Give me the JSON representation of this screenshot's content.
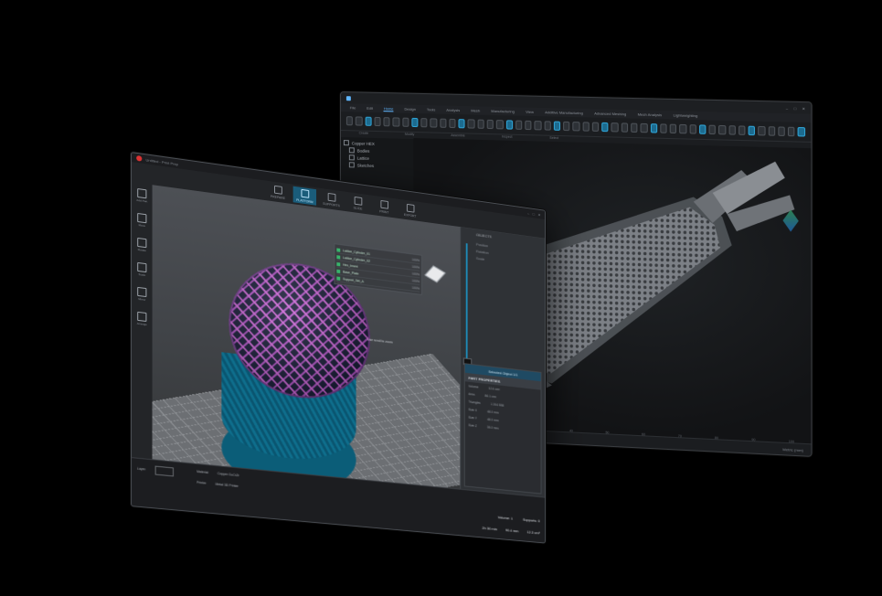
{
  "back_window": {
    "title": "Copper HEX",
    "menu_tabs": [
      "File",
      "Edit",
      "Home",
      "Design",
      "Tools",
      "Analysis",
      "Mesh",
      "Manufacturing",
      "View",
      "Additive Manufacturing",
      "Advanced Meshing",
      "Mesh Analysis",
      "Lightweighting"
    ],
    "active_tab_index": 2,
    "ribbon_groups": [
      "Create",
      "Modify",
      "Assemble",
      "Inspect",
      "Select"
    ],
    "tree_items": [
      "Copper HEX",
      "Bodies",
      "Lattice",
      "Sketches"
    ],
    "ruler_ticks": [
      "0",
      "10",
      "20",
      "30",
      "40",
      "50",
      "60",
      "70",
      "80",
      "90",
      "100"
    ],
    "status_left": "Ready",
    "status_right": "Metric (mm)"
  },
  "front_window": {
    "title": "Untitled - Print Prep",
    "steps": [
      {
        "label": "PREPARE"
      },
      {
        "label": "PLATFORM"
      },
      {
        "label": "SUPPORTS"
      },
      {
        "label": "SLICE"
      },
      {
        "label": "PRINT"
      },
      {
        "label": "EXPORT"
      }
    ],
    "active_step_index": 1,
    "tools": [
      "Add Part",
      "Move",
      "Rotate",
      "Scale",
      "Mirror",
      "Arrange"
    ],
    "objects": [
      {
        "name": "Lattice_Cylinder_01",
        "pct": "100%"
      },
      {
        "name": "Lattice_Cylinder_02",
        "pct": "100%"
      },
      {
        "name": "Hex_Insert",
        "pct": "100%"
      },
      {
        "name": "Base_Plate",
        "pct": "100%"
      },
      {
        "name": "Support_Set_A",
        "pct": "100%"
      }
    ],
    "viewport_hint": "Use scroll to zoom",
    "right_panel": {
      "title": "OBJECTS",
      "rows": [
        "Position",
        "Rotation",
        "Scale"
      ]
    },
    "properties": {
      "object_name": "Selected Object 1/1",
      "header": "PART PROPERTIES",
      "lines": [
        {
          "k": "Volume",
          "v": "12.4 cm³"
        },
        {
          "k": "Area",
          "v": "86.1 cm²"
        },
        {
          "k": "Triangles",
          "v": "1 204 558"
        },
        {
          "k": "Size X",
          "v": "48.0 mm"
        },
        {
          "k": "Size Y",
          "v": "48.0 mm"
        },
        {
          "k": "Size Z",
          "v": "35.0 mm"
        }
      ]
    },
    "statusbar": {
      "layer_label": "Layer",
      "material_label": "Material",
      "material_value": "Copper CuCrZr",
      "printer_label": "Printer",
      "printer_value": "Metal 3D Printer",
      "stats": [
        "Volume: 1",
        "Supports: 0"
      ],
      "totals": [
        "2h 30 min",
        "90.4 mm",
        "12.3 cm³"
      ]
    }
  }
}
